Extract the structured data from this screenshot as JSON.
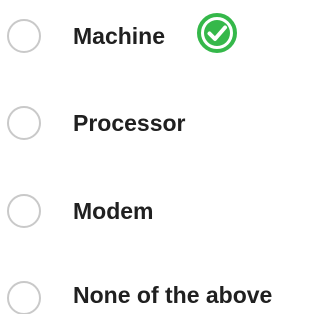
{
  "options": [
    {
      "label": "Machine",
      "selected": false,
      "correct": true
    },
    {
      "label": "Processor",
      "selected": false,
      "correct": false
    },
    {
      "label": "Modem",
      "selected": false,
      "correct": false
    },
    {
      "label": "None of the above",
      "selected": false,
      "correct": false
    }
  ],
  "icons": {
    "correct_indicator": "check-circle-icon"
  },
  "colors": {
    "radio_border": "#c9c9c9",
    "text": "#202020",
    "correct_green": "#35b84a",
    "correct_green_dark": "#1f9a35"
  }
}
